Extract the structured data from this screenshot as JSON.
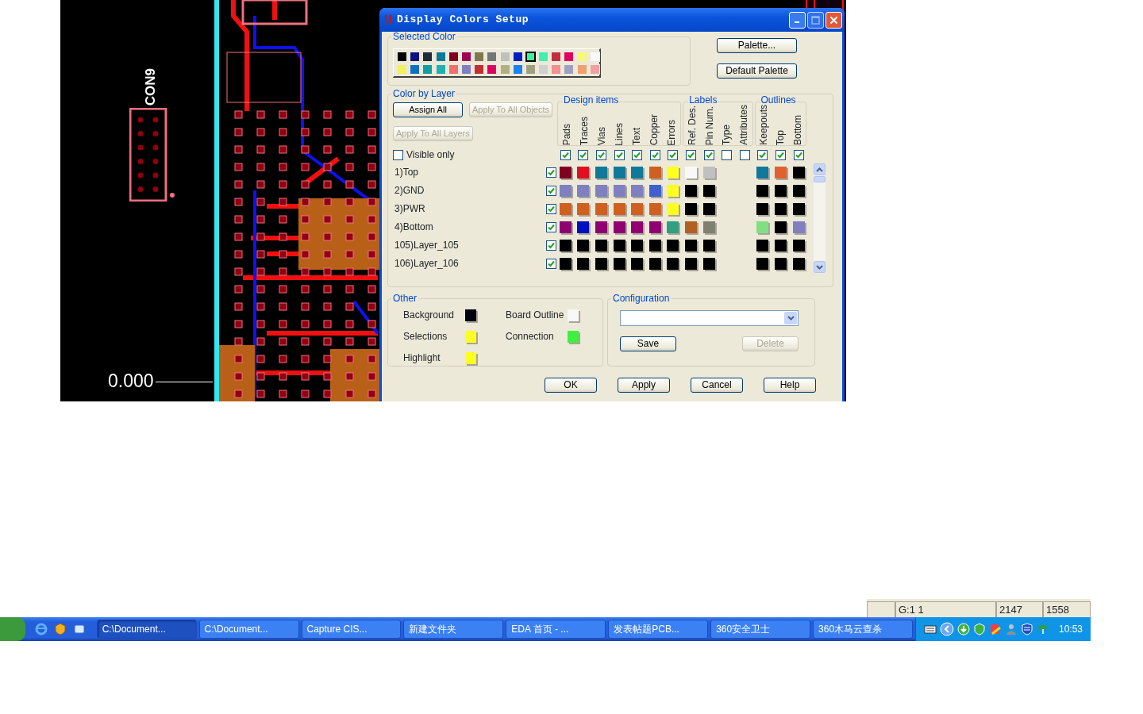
{
  "pcb_canvas": {
    "connector_label": "CON9",
    "coordinate_readout": "0.000"
  },
  "dialog": {
    "title": "Display Colors Setup",
    "selected_color": {
      "title": "Selected Color",
      "palette": [
        {
          "color": "#000000",
          "selected": false
        },
        {
          "color": "#0a1480",
          "selected": false
        },
        {
          "color": "#1f2a3a",
          "selected": false
        },
        {
          "color": "#0a7a98",
          "selected": false
        },
        {
          "color": "#800020",
          "selected": false
        },
        {
          "color": "#a00050",
          "selected": false
        },
        {
          "color": "#807850",
          "selected": false
        },
        {
          "color": "#707878",
          "selected": false
        },
        {
          "color": "#c0c0c0",
          "selected": false
        },
        {
          "color": "#0020c0",
          "selected": false
        },
        {
          "color": "#40f0a0",
          "selected": true
        },
        {
          "color": "#40f0b0",
          "selected": false
        },
        {
          "color": "#c03040",
          "selected": false
        },
        {
          "color": "#e00060",
          "selected": false
        },
        {
          "color": "#f8f878",
          "selected": false
        },
        {
          "color": "#f8f8f8",
          "selected": false
        },
        {
          "color": "#f0f060",
          "selected": false
        },
        {
          "color": "#1070c0",
          "selected": false
        },
        {
          "color": "#10a0a0",
          "selected": false
        },
        {
          "color": "#20b0b0",
          "selected": false
        },
        {
          "color": "#f07070",
          "selected": false
        },
        {
          "color": "#8080c0",
          "selected": false
        },
        {
          "color": "#c03030",
          "selected": false
        },
        {
          "color": "#e00060",
          "selected": false
        },
        {
          "color": "#b0b080",
          "selected": false
        },
        {
          "color": "#2080f0",
          "selected": false
        },
        {
          "color": "#a0a080",
          "selected": false
        },
        {
          "color": "#d0d0d0",
          "selected": false
        },
        {
          "color": "#f09090",
          "selected": false
        },
        {
          "color": "#a0a0c0",
          "selected": false
        },
        {
          "color": "#f0a070",
          "selected": false
        },
        {
          "color": "#f0a0a0",
          "selected": false
        }
      ]
    },
    "palette_button": "Palette...",
    "default_palette_button": "Default Palette",
    "color_by_layer": {
      "title": "Color by Layer",
      "buttons": [
        {
          "label": "Assign All",
          "disabled": false
        },
        {
          "label": "Apply To All Objects",
          "disabled": true
        },
        {
          "label": "Apply To All Layers",
          "disabled": true
        }
      ],
      "visible_only": {
        "label": "Visible only",
        "checked": false
      },
      "groups": [
        {
          "title": "Design items",
          "columns": [
            {
              "label": "Pads",
              "checked": true
            },
            {
              "label": "Traces",
              "checked": true
            },
            {
              "label": "Vias",
              "checked": true
            },
            {
              "label": "Lines",
              "checked": true
            },
            {
              "label": "Text",
              "checked": true
            },
            {
              "label": "Copper",
              "checked": true
            },
            {
              "label": "Errors",
              "checked": true
            }
          ]
        },
        {
          "title": "Labels",
          "columns": [
            {
              "label": "Ref. Des.",
              "checked": true
            },
            {
              "label": "Pin Num.",
              "checked": true
            },
            {
              "label": "Type",
              "checked": false
            },
            {
              "label": "Attributes",
              "checked": false
            }
          ]
        },
        {
          "title": "Outlines",
          "columns": [
            {
              "label": "Keepouts",
              "checked": true
            },
            {
              "label": "Top",
              "checked": true
            },
            {
              "label": "Bottom",
              "checked": true
            }
          ]
        }
      ],
      "layers": [
        {
          "name": "1)Top",
          "checked": true,
          "design_items": [
            {
              "color": "#800020"
            },
            {
              "color": "#e01020"
            },
            {
              "color": "#107898"
            },
            {
              "color": "#107898"
            },
            {
              "color": "#107898"
            },
            {
              "color": "#d06020"
            },
            {
              "color": "#ffff20"
            }
          ],
          "labels": [
            {
              "color": "#f8f8f8"
            },
            {
              "color": "#c0c0c0"
            }
          ],
          "outlines": [
            {
              "color": "#107898"
            },
            {
              "color": "#e06030"
            },
            {
              "color": "#000000"
            }
          ]
        },
        {
          "name": "2)GND",
          "checked": true,
          "design_items": [
            {
              "color": "#8080c0"
            },
            {
              "color": "#8080c0"
            },
            {
              "color": "#8080c0"
            },
            {
              "color": "#8080c0"
            },
            {
              "color": "#8080c0"
            },
            {
              "color": "#4060d0"
            },
            {
              "color": "#ffff20"
            }
          ],
          "labels": [
            {
              "color": "#000000"
            },
            {
              "color": "#000000"
            }
          ],
          "outlines": [
            {
              "color": "#000000"
            },
            {
              "color": "#000000"
            },
            {
              "color": "#000000"
            }
          ]
        },
        {
          "name": "3)PWR",
          "checked": true,
          "design_items": [
            {
              "color": "#d06020"
            },
            {
              "color": "#d06020"
            },
            {
              "color": "#d06020"
            },
            {
              "color": "#d06020"
            },
            {
              "color": "#d06020"
            },
            {
              "color": "#d06020"
            },
            {
              "color": "#ffff20"
            }
          ],
          "labels": [
            {
              "color": "#000000"
            },
            {
              "color": "#000000"
            }
          ],
          "outlines": [
            {
              "color": "#000000"
            },
            {
              "color": "#000000"
            },
            {
              "color": "#000000"
            }
          ]
        },
        {
          "name": "4)Bottom",
          "checked": true,
          "design_items": [
            {
              "color": "#900070"
            },
            {
              "color": "#0010c0"
            },
            {
              "color": "#900070"
            },
            {
              "color": "#900070"
            },
            {
              "color": "#900070"
            },
            {
              "color": "#900070"
            },
            {
              "color": "#30a080"
            }
          ],
          "labels": [
            {
              "color": "#b06020"
            },
            {
              "color": "#808070"
            }
          ],
          "outlines": [
            {
              "color": "#80e080"
            },
            {
              "color": "#000000"
            },
            {
              "color": "#8080c0"
            }
          ]
        },
        {
          "name": "105)Layer_105",
          "checked": true,
          "design_items": [
            {
              "color": "#000000"
            },
            {
              "color": "#000000"
            },
            {
              "color": "#000000"
            },
            {
              "color": "#000000"
            },
            {
              "color": "#000000"
            },
            {
              "color": "#000000"
            },
            {
              "color": "#000000"
            }
          ],
          "labels": [
            {
              "color": "#000000"
            },
            {
              "color": "#000000"
            }
          ],
          "outlines": [
            {
              "color": "#000000"
            },
            {
              "color": "#000000"
            },
            {
              "color": "#000000"
            }
          ]
        },
        {
          "name": "106)Layer_106",
          "checked": true,
          "design_items": [
            {
              "color": "#000000"
            },
            {
              "color": "#000000"
            },
            {
              "color": "#000000"
            },
            {
              "color": "#000000"
            },
            {
              "color": "#000000"
            },
            {
              "color": "#000000"
            },
            {
              "color": "#000000"
            }
          ],
          "labels": [
            {
              "color": "#000000"
            },
            {
              "color": "#000000"
            }
          ],
          "outlines": [
            {
              "color": "#000000"
            },
            {
              "color": "#000000"
            },
            {
              "color": "#000000"
            }
          ]
        }
      ]
    },
    "other": {
      "title": "Other",
      "items": [
        {
          "label": "Background",
          "color": "#000010"
        },
        {
          "label": "Board Outline",
          "color": "#f8f8f8"
        },
        {
          "label": "Selections",
          "color": "#ffff20"
        },
        {
          "label": "Connection",
          "color": "#40f040"
        },
        {
          "label": "Highlight",
          "color": "#ffff20"
        }
      ]
    },
    "configuration": {
      "title": "Configuration",
      "buttons": [
        {
          "label": "Save",
          "disabled": false
        },
        {
          "label": "Delete",
          "disabled": true
        }
      ]
    },
    "footer_buttons": [
      "OK",
      "Apply",
      "Cancel",
      "Help"
    ]
  },
  "status_bar": {
    "cells": [
      "G:1 1",
      "2147",
      "1558"
    ]
  },
  "taskbar": {
    "tasks": [
      {
        "label": "C:\\Document...",
        "selected": true
      },
      {
        "label": "C:\\Document...",
        "selected": false
      },
      {
        "label": "Capture CIS...",
        "selected": false
      },
      {
        "label": "新建文件夹",
        "selected": false
      },
      {
        "label": "EDA 首页 - ...",
        "selected": false
      },
      {
        "label": "发表帖题PCB...",
        "selected": false
      },
      {
        "label": "360安全卫士",
        "selected": false
      },
      {
        "label": "360木马云查杀",
        "selected": false
      }
    ],
    "clock": "10:53"
  }
}
